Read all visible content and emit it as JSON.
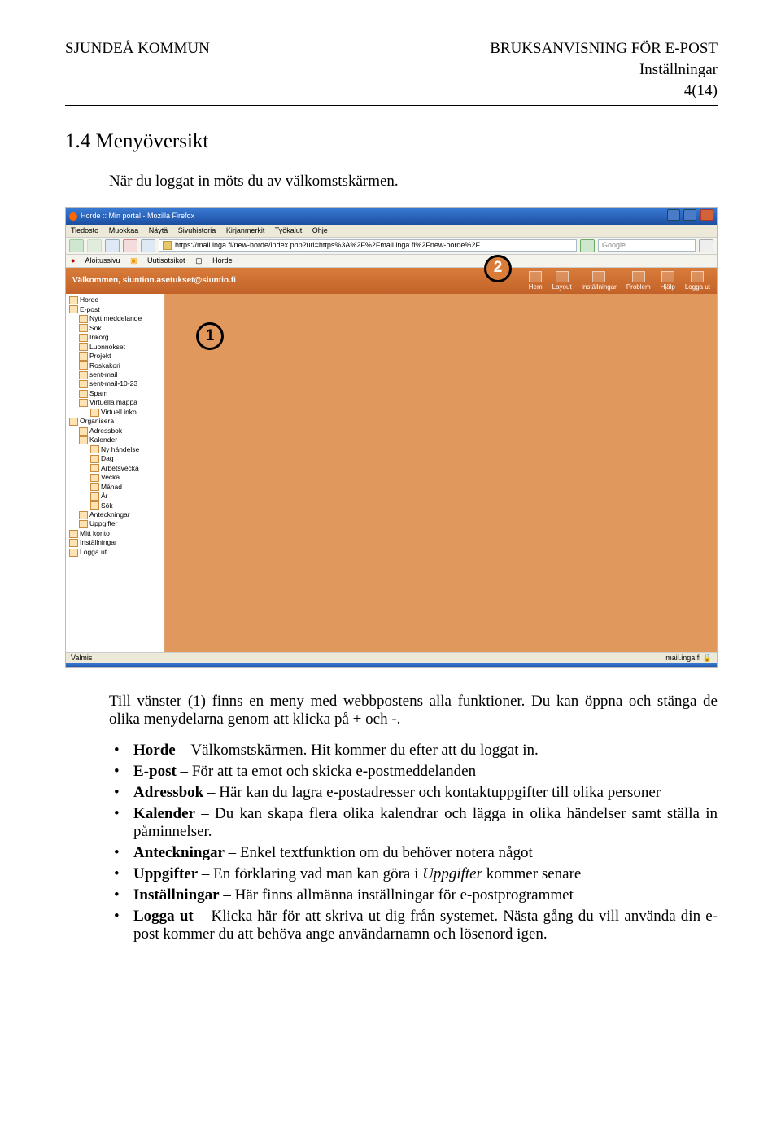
{
  "header": {
    "left": "SJUNDEÅ KOMMUN",
    "right1": "BRUKSANVISNING FÖR E-POST",
    "right2": "Inställningar",
    "page": "4(14)"
  },
  "section_title": "1.4 Menyöversikt",
  "intro": "När du loggat in möts du av välkomstskärmen.",
  "screenshot": {
    "window_title": "Horde :: Min portal - Mozilla Firefox",
    "menus": [
      "Tiedosto",
      "Muokkaa",
      "Näytä",
      "Sivuhistoria",
      "Kirjanmerkit",
      "Työkalut",
      "Ohje"
    ],
    "url": "https://mail.inga.fi/new-horde/index.php?url=https%3A%2F%2Fmail.inga.fi%2Fnew-horde%2F",
    "search_placeholder": "Google",
    "bookmarks": [
      "Aloitussivu",
      "Uutisotsikot",
      "Horde"
    ],
    "welcome": "Välkommen, siuntion.asetukset@siuntio.fi",
    "top_icons": [
      "Hem",
      "Layout",
      "Inställningar",
      "Problem",
      "Hjälp",
      "Logga ut"
    ],
    "tree": [
      {
        "lvl": 0,
        "label": "Horde"
      },
      {
        "lvl": 0,
        "label": "E-post"
      },
      {
        "lvl": 1,
        "label": "Nytt meddelande"
      },
      {
        "lvl": 1,
        "label": "Sök"
      },
      {
        "lvl": 1,
        "label": "Inkorg"
      },
      {
        "lvl": 1,
        "label": "Luonnokset"
      },
      {
        "lvl": 1,
        "label": "Projekt"
      },
      {
        "lvl": 1,
        "label": "Roskakori"
      },
      {
        "lvl": 1,
        "label": "sent-mail"
      },
      {
        "lvl": 1,
        "label": "sent-mail-10-23"
      },
      {
        "lvl": 1,
        "label": "Spam"
      },
      {
        "lvl": 1,
        "label": "Virtuella mappa"
      },
      {
        "lvl": 2,
        "label": "Virtuell inko"
      },
      {
        "lvl": 0,
        "label": "Organisera"
      },
      {
        "lvl": 1,
        "label": "Adressbok"
      },
      {
        "lvl": 1,
        "label": "Kalender"
      },
      {
        "lvl": 2,
        "label": "Ny händelse"
      },
      {
        "lvl": 2,
        "label": "Dag"
      },
      {
        "lvl": 2,
        "label": "Arbetsvecka"
      },
      {
        "lvl": 2,
        "label": "Vecka"
      },
      {
        "lvl": 2,
        "label": "Månad"
      },
      {
        "lvl": 2,
        "label": "År"
      },
      {
        "lvl": 2,
        "label": "Sök"
      },
      {
        "lvl": 1,
        "label": "Anteckningar"
      },
      {
        "lvl": 1,
        "label": "Uppgifter"
      },
      {
        "lvl": 0,
        "label": "Mitt konto"
      },
      {
        "lvl": 0,
        "label": "Inställningar"
      },
      {
        "lvl": 0,
        "label": "Logga ut"
      }
    ],
    "status_left": "Valmis",
    "status_right": "mail.inga.fi",
    "callout1": "1",
    "callout2": "2"
  },
  "para1": "Till vänster (1) finns en meny med webbpostens alla funktioner. Du kan öppna och stänga de olika menydelarna genom att klicka på + och -.",
  "bullets": [
    {
      "bold": "Horde",
      "rest": " – Välkomstskärmen. Hit kommer du efter att du loggat in."
    },
    {
      "bold": "E-post",
      "rest": " – För att ta emot och skicka e-postmeddelanden"
    },
    {
      "bold": "Adressbok",
      "rest": " – Här kan du lagra e-postadresser och kontaktuppgifter till olika personer"
    },
    {
      "bold": "Kalender",
      "rest": " – Du kan skapa flera olika kalendrar och lägga in olika händelser samt ställa in påminnelser."
    },
    {
      "bold": "Anteckningar",
      "rest": " – Enkel textfunktion om du behöver notera något"
    },
    {
      "bold": "Uppgifter",
      "rest_a": " – En förklaring vad man kan göra i ",
      "italic": "Uppgifter",
      "rest_b": " kommer senare"
    },
    {
      "bold": "Inställningar",
      "rest": " – Här  finns allmänna inställningar för e-postprogrammet"
    },
    {
      "bold": "Logga ut",
      "rest": " – Klicka här för att skriva ut dig från systemet. Nästa gång du vill använda din e-post kommer du att behöva ange användarnamn och lösenord igen."
    }
  ]
}
